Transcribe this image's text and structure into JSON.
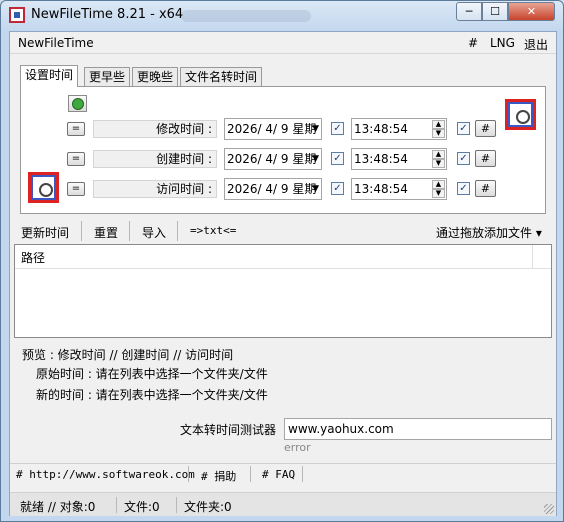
{
  "window": {
    "title": "NewFileTime 8.21 - x64",
    "min_glyph": "─",
    "max_glyph": "☐",
    "close_glyph": "✕"
  },
  "menu": {
    "app": "NewFileTime",
    "hash": "#",
    "lng": "LNG",
    "exit": "退出"
  },
  "tabs": [
    {
      "label": "设置时间",
      "active": true
    },
    {
      "label": "更早些",
      "active": false
    },
    {
      "label": "更晚些",
      "active": false
    },
    {
      "label": "文件名转时间",
      "active": false
    }
  ],
  "time_rows": [
    {
      "eq": "=",
      "label": "修改时间 :",
      "date": "2026/ 4/ 9 星期",
      "time": "13:48:54",
      "date_checked": true,
      "time_checked": true,
      "hash": "#"
    },
    {
      "eq": "=",
      "label": "创建时间 :",
      "date": "2026/ 4/ 9 星期",
      "time": "13:48:54",
      "date_checked": true,
      "time_checked": true,
      "hash": "#"
    },
    {
      "eq": "=",
      "label": "访问时间 :",
      "date": "2026/ 4/ 9 星期",
      "time": "13:48:54",
      "date_checked": true,
      "time_checked": true,
      "hash": "#"
    }
  ],
  "toolbar": {
    "update": "更新时间",
    "reset": "重置",
    "import": "导入",
    "txt": "=>txt<=",
    "drag_add": "通过拖放添加文件 ▾"
  },
  "list": {
    "column_path": "路径"
  },
  "preview": {
    "heading": "预览 :   修改时间   //   创建时间   //   访问时间",
    "original": "原始时间 : 请在列表中选择一个文件夹/文件",
    "new": "新的时间 : 请在列表中选择一个文件夹/文件"
  },
  "converter": {
    "label": "文本转时间测试器",
    "input_value": "www.yaohux.com",
    "result": "error"
  },
  "links": {
    "website": "# http://www.softwareok.com",
    "donate": "# 捐助",
    "faq": "# FAQ"
  },
  "status": {
    "ready": "就绪  //  对象:0",
    "files": "文件:0",
    "folders": "文件夹:0"
  }
}
